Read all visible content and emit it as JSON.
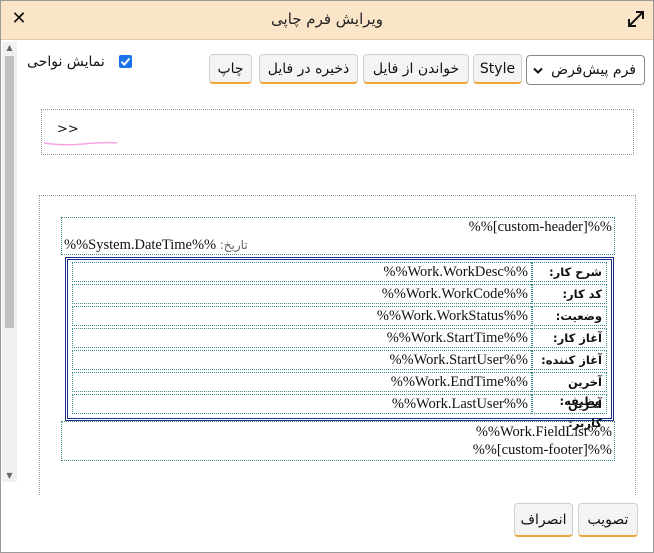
{
  "dialog": {
    "title": "ویرایش فرم چاپی",
    "close_glyph": "✕"
  },
  "toolbar": {
    "template_select": "فرم پیش‌فرض",
    "style_label": "Style",
    "load_label": "خواندن از فایل",
    "save_label": "ذخیره در فایل",
    "print_label": "چاپ",
    "show_regions_label": "نمایش نواحی",
    "show_regions_checked": true
  },
  "breadcrumb": {
    "text": ">>"
  },
  "preview": {
    "header_placeholder": "%%[custom-header]%%",
    "date_label": "تاریخ:",
    "date_value": "%%System.DateTime%%",
    "rows": [
      {
        "label": "شرح کار:",
        "value": "%%Work.WorkDesc%%"
      },
      {
        "label": "کد کار:",
        "value": "%%Work.WorkCode%%"
      },
      {
        "label": "وضعیت:",
        "value": "%%Work.WorkStatus%%"
      },
      {
        "label": "آغاز کار:",
        "value": "%%Work.StartTime%%"
      },
      {
        "label": "آغاز کننده:",
        "value": "%%Work.StartUser%%"
      },
      {
        "label": "آخرین وظیفه:",
        "value": "%%Work.EndTime%%"
      },
      {
        "label": "آخرین کاربر:",
        "value": "%%Work.LastUser%%"
      }
    ],
    "field_list": "%%Work.FieldList%%",
    "footer_placeholder": "%%[custom-footer]%%"
  },
  "footer": {
    "approve_label": "تصویب",
    "cancel_label": "انصراف"
  },
  "colors": {
    "titlebar_bg": "#fae5c8",
    "button_accent": "#f0a53a",
    "checkbox": "#1a73e8",
    "table_border": "#1a2f8a",
    "cell_border": "#3a8a8a",
    "breadcrumb_underline": "#f6a4e0"
  },
  "icons": {
    "close": "close-icon",
    "expand": "expand-icon",
    "select_chevron": "chevron-down-icon",
    "checkbox": "checkmark-icon"
  }
}
